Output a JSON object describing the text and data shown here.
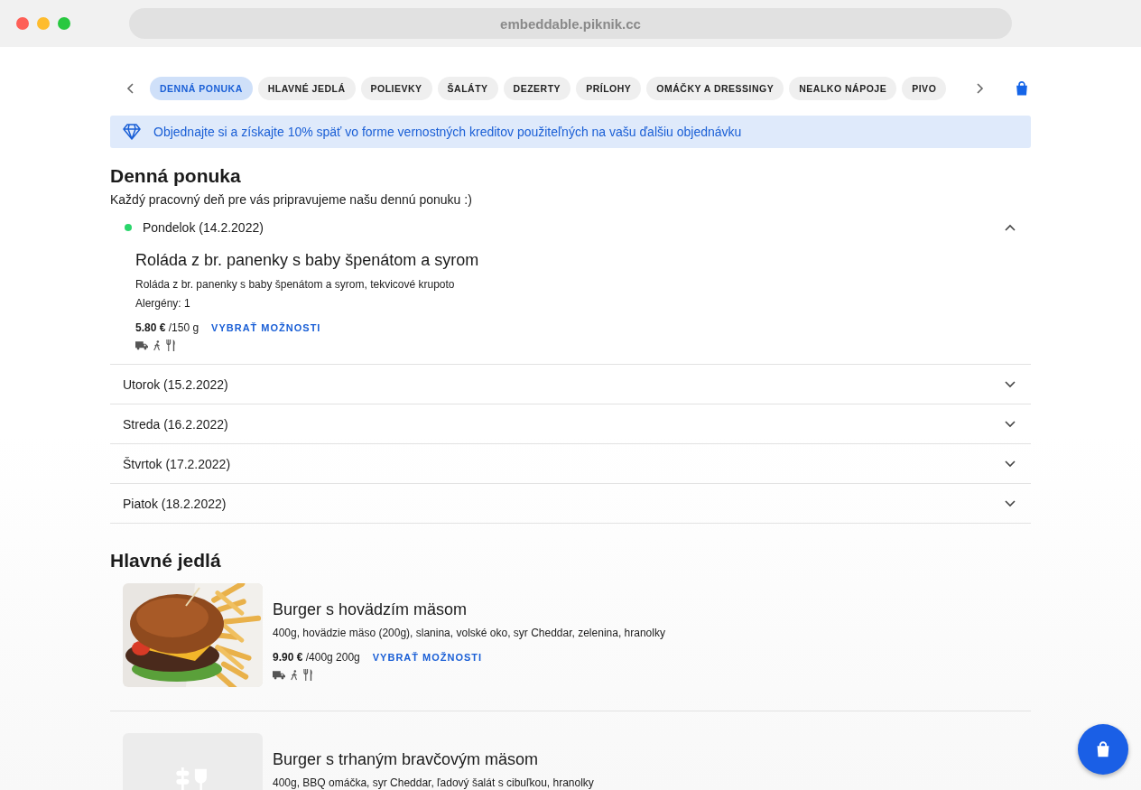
{
  "browser": {
    "url": "embeddable.piknik.cc"
  },
  "categories": [
    {
      "label": "DENNÁ PONUKA",
      "selected": true
    },
    {
      "label": "HLAVNÉ JEDLÁ",
      "selected": false
    },
    {
      "label": "POLIEVKY",
      "selected": false
    },
    {
      "label": "ŠALÁTY",
      "selected": false
    },
    {
      "label": "DEZERTY",
      "selected": false
    },
    {
      "label": "PRÍLOHY",
      "selected": false
    },
    {
      "label": "OMÁČKY A DRESSINGY",
      "selected": false
    },
    {
      "label": "NEALKO NÁPOJE",
      "selected": false
    },
    {
      "label": "PIVO",
      "selected": false
    }
  ],
  "promo": {
    "text": "Objednajte si a získajte 10% späť vo forme vernostných kreditov použiteľných na vašu ďalšiu objednávku"
  },
  "daily": {
    "title": "Denná ponuka",
    "subtitle": "Každý pracovný deň pre vás pripravujeme našu dennú ponuku :)",
    "days": [
      {
        "label": "Pondelok (14.2.2022)",
        "today": true,
        "expanded": true,
        "items": [
          {
            "name": "Roláda z br. panenky s baby špenátom a syrom",
            "description": "Roláda z br. panenky s baby špenátom a syrom, tekvicové krupoto",
            "allergens": "Alergény: 1",
            "price": "5.80 €",
            "unit": "/150 g",
            "action": "VYBRAŤ MOŽNOSTI"
          }
        ]
      },
      {
        "label": "Utorok (15.2.2022)",
        "today": false,
        "expanded": false
      },
      {
        "label": "Streda (16.2.2022)",
        "today": false,
        "expanded": false
      },
      {
        "label": "Štvrtok (17.2.2022)",
        "today": false,
        "expanded": false
      },
      {
        "label": "Piatok (18.2.2022)",
        "today": false,
        "expanded": false
      }
    ]
  },
  "mains": {
    "title": "Hlavné jedlá",
    "products": [
      {
        "kind": "picture",
        "name": "Burger s hovädzím mäsom",
        "description": "400g, hovädzie mäso (200g), slanina, volské oko, syr Cheddar, zelenina, hranolky",
        "price": "9.90 €",
        "unit": "/400g 200g",
        "action": "VYBRAŤ MOŽNOSTI"
      },
      {
        "kind": "placeholder",
        "name": "Burger s trhaným bravčovým mäsom",
        "description": "400g, BBQ omáčka, syr Cheddar, ľadový šalát s cibuľkou, hranolky"
      }
    ]
  }
}
